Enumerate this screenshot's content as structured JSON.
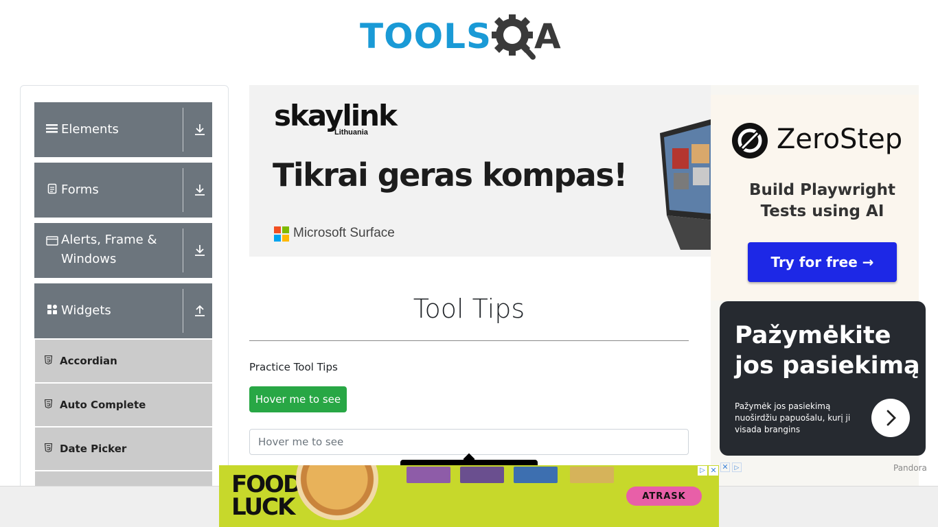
{
  "brand": {
    "logo_left": "TOOLS",
    "logo_right": "A"
  },
  "sidebar": {
    "groups": [
      {
        "label": "Elements",
        "icon": "hamburger-icon",
        "arrow": "download-icon"
      },
      {
        "label": "Forms",
        "icon": "document-icon",
        "arrow": "download-icon"
      },
      {
        "label": "Alerts, Frame & Windows",
        "icon": "window-icon",
        "arrow": "download-icon"
      },
      {
        "label": "Widgets",
        "icon": "grid-icon",
        "arrow": "upload-icon"
      }
    ],
    "widget_items": [
      {
        "label": "Accordian",
        "icon": "html5-icon"
      },
      {
        "label": "Auto Complete",
        "icon": "html5-icon"
      },
      {
        "label": "Date Picker",
        "icon": "html5-icon"
      }
    ]
  },
  "ad_skaylink": {
    "brand": "skaylink",
    "sub": "Lithuania",
    "headline": "Tikrai geras kompas!",
    "partner": "Microsoft Surface",
    "colors": {
      "red": "#f25022",
      "green": "#7fba00",
      "blue": "#00a4ef",
      "yellow": "#ffb900"
    }
  },
  "main": {
    "title": "Tool Tips",
    "practice_label": "Practice Tool Tips",
    "button_label": "Hover me to see",
    "input_placeholder": "Hover me to see"
  },
  "ad_zerostep": {
    "name": "ZeroStep",
    "tagline": "Build Playwright Tests using AI",
    "cta": "Try for free →",
    "cta_color": "#1d28e6"
  },
  "ad_pandora": {
    "headline": "Pažymėkite jos pasiekimą",
    "body": "Pažymėk jos pasiekimą nuoširdžiu papuošalu, kurį ji visada brangins",
    "label": "Pandora"
  },
  "ad_food": {
    "logo": "FOOD LUCK",
    "cta": "ATRASK"
  },
  "colors": {
    "sidebar_group": "#6c757d",
    "sidebar_item": "#cbcbcb",
    "success": "#28a745",
    "logo_blue": "#1a9ad6"
  }
}
